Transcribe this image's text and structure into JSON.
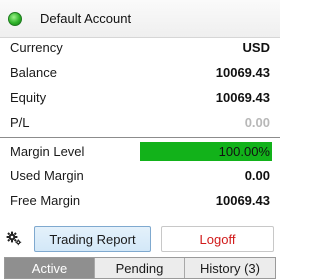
{
  "header": {
    "account_name": "Default Account",
    "status_color": "#2fb32a"
  },
  "summary": [
    {
      "label": "Currency",
      "value": "USD"
    },
    {
      "label": "Balance",
      "value": "10069.43"
    },
    {
      "label": "Equity",
      "value": "10069.43"
    },
    {
      "label": "P/L",
      "value": "0.00"
    }
  ],
  "margin": {
    "level_label": "Margin Level",
    "level_value": "100.00%",
    "level_fraction": 1.0,
    "bar_color": "#12b21a",
    "used_label": "Used Margin",
    "used_value": "0.00",
    "free_label": "Free Margin",
    "free_value": "10069.43"
  },
  "actions": {
    "settings_icon": "gear-icon",
    "report_label": "Trading Report",
    "logoff_label": "Logoff",
    "logoff_color": "#d11a1a"
  },
  "tabs": [
    {
      "label": "Active",
      "active": true
    },
    {
      "label": "Pending",
      "active": false
    },
    {
      "label": "History (3)",
      "active": false
    }
  ]
}
